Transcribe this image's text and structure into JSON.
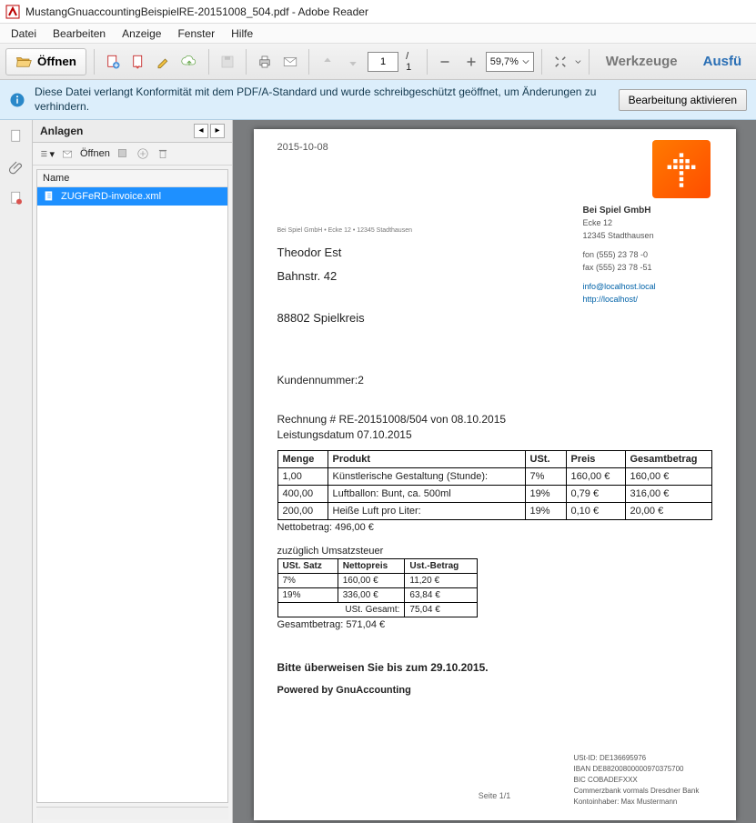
{
  "window": {
    "title": "MustangGnuaccountingBeispielRE-20151008_504.pdf - Adobe Reader"
  },
  "menu": {
    "items": [
      "Datei",
      "Bearbeiten",
      "Anzeige",
      "Fenster",
      "Hilfe"
    ]
  },
  "toolbar": {
    "open_label": "Öffnen",
    "page_current": "1",
    "page_total": "/ 1",
    "zoom": "59,7%",
    "tools_label": "Werkzeuge",
    "sign_label": "Ausfü"
  },
  "infobar": {
    "text": "Diese Datei verlangt Konformität mit dem PDF/A-Standard und wurde schreibgeschützt geöffnet, um Änderungen zu verhindern.",
    "button": "Bearbeitung aktivieren"
  },
  "attachments": {
    "header": "Anlagen",
    "open": "Öffnen",
    "col_name": "Name",
    "file": "ZUGFeRD-invoice.xml"
  },
  "doc": {
    "date": "2015-10-08",
    "company": {
      "name": "Bei Spiel GmbH",
      "street": "Ecke 12",
      "city": "12345 Stadthausen",
      "fon": "fon  (555) 23 78 -0",
      "fax": "fax  (555) 23 78 -51",
      "email": "info@localhost.local",
      "url": "http://localhost/"
    },
    "sender_line": "Bei Spiel GmbH   •   Ecke 12   •   12345 Stadthausen",
    "recipient": {
      "name": "Theodor Est",
      "street": "Bahnstr. 42",
      "city": "88802 Spielkreis"
    },
    "customer_no": "Kundennummer:2",
    "invoice_line": "Rechnung # RE-20151008/504 von 08.10.2015",
    "service_date": "Leistungsdatum 07.10.2015",
    "items_header": {
      "qty": "Menge",
      "prod": "Produkt",
      "vat": "USt.",
      "price": "Preis",
      "total": "Gesamtbetrag"
    },
    "items": [
      {
        "qty": "1,00",
        "prod": "Künstlerische Gestaltung (Stunde):",
        "vat": "7%",
        "price": "160,00 €",
        "total": "160,00 €"
      },
      {
        "qty": "400,00",
        "prod": "Luftballon: Bunt, ca. 500ml",
        "vat": "19%",
        "price": "0,79 €",
        "total": "316,00 €"
      },
      {
        "qty": "200,00",
        "prod": "Heiße Luft pro Liter:",
        "vat": "19%",
        "price": "0,10 €",
        "total": "20,00 €"
      }
    ],
    "net": "Nettobetrag: 496,00 €",
    "tax_label": "zuzüglich Umsatzsteuer",
    "tax_header": {
      "rate": "USt. Satz",
      "net": "Nettopreis",
      "amt": "Ust.-Betrag"
    },
    "tax_rows": [
      {
        "rate": "7%",
        "net": "160,00 €",
        "amt": "11,20 €"
      },
      {
        "rate": "19%",
        "net": "336,00 €",
        "amt": "63,84 €"
      }
    ],
    "tax_total_label": "USt. Gesamt:",
    "tax_total": "75,04 €",
    "grand_total": "Gesamtbetrag: 571,04 €",
    "pay_notice": "Bitte überweisen Sie bis zum 29.10.2015.",
    "powered": "Powered by GnuAccounting",
    "page_no": "Seite 1/1",
    "bank": {
      "ustid": "USt-ID: DE136695976",
      "iban": "IBAN DE88200800000970375700",
      "bic": "BIC COBADEFXXX",
      "bankname": "Commerzbank vormals Dresdner Bank",
      "owner": "Kontoinhaber: Max Mustermann"
    }
  }
}
